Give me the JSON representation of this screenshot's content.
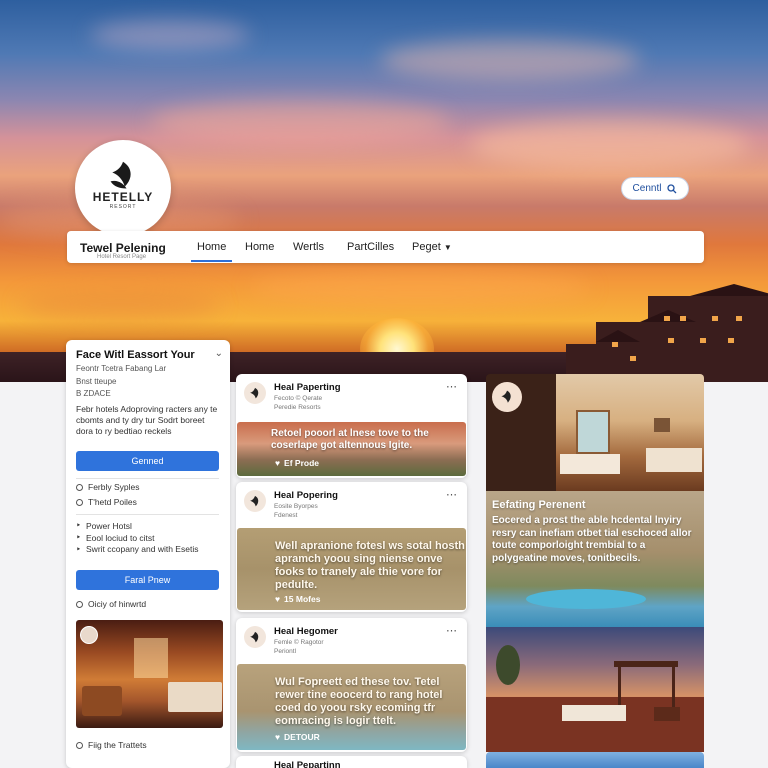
{
  "brand": {
    "logo_text": "HETELLY",
    "logo_sub": "RESORT"
  },
  "search": {
    "label": "Cenntl"
  },
  "nav": {
    "title": "Tewel Pelening",
    "subtitle": "Hotel Resort Page",
    "tabs": [
      {
        "label": "Home",
        "active": true
      },
      {
        "label": "Home",
        "active": false
      },
      {
        "label": "Wertls",
        "active": false
      },
      {
        "label": "PartCilles",
        "active": false
      },
      {
        "label": "Peget",
        "active": false
      }
    ],
    "dropdown_icon": "chevron-down-icon"
  },
  "left_panel": {
    "title": "Face Witl Eassort Your",
    "line1": "Feontr Tcetra Fabang Lar",
    "line2": "Bnst tteupe",
    "line3": "B ZDACE",
    "description": "Febr hotels Adoproving racters any te cbomts and ty dry tur Sodrt boreet dora to ry bedtiao reckels",
    "primary_button": "Genned",
    "options": [
      "Ferbly Syples",
      "T'hetd Poiles"
    ],
    "list": [
      "Power Hotsl",
      "Eool lociud to citst",
      "Swrit ccopany and with Esetis"
    ],
    "secondary_button": "Faral Pnew",
    "checkbox_label": "Oiciy of hinwrtd",
    "footer_label": "Fiig the Trattets"
  },
  "posts": [
    {
      "name": "Heal Paperting",
      "meta1": "Fecoto © Qerate",
      "meta2": "Peredie Resorts",
      "caption": "Retoel pooorl at lnese tove to the coserlape got altennous Igite.",
      "likes": "Ef Prode"
    },
    {
      "name": "Heal Popering",
      "meta1": "Eosite Byorpes",
      "meta2": "Fdenest",
      "caption": "Well apranione fotesl ws sotal hosth apramch yoou sing niense onve fooks to tranely ale thie vore for pedulte.",
      "likes": "15 Mofes"
    },
    {
      "name": "Heal Hegomer",
      "meta1": "Femle © Ragotor",
      "meta2": "Periontl",
      "caption": "Wul Fopreett ed these tov. Tetel rewer tine eoocerd to rang hotel coed do yoou rsky ecoming tfr eomracing is Iogir ttelt.",
      "likes": "DETOUR"
    },
    {
      "name": "Heal Pepartinn"
    }
  ],
  "feature": {
    "title": "Eefating Perenent",
    "text": "Eocered a prost the able hcdental lnyiry resry can inefiam otbet tial eschoced allor toute comporloight trembial to a polygeatine moves, tonitbecils."
  },
  "colors": {
    "accent": "#2f73dc",
    "nav_active": "#2d6fd8"
  }
}
